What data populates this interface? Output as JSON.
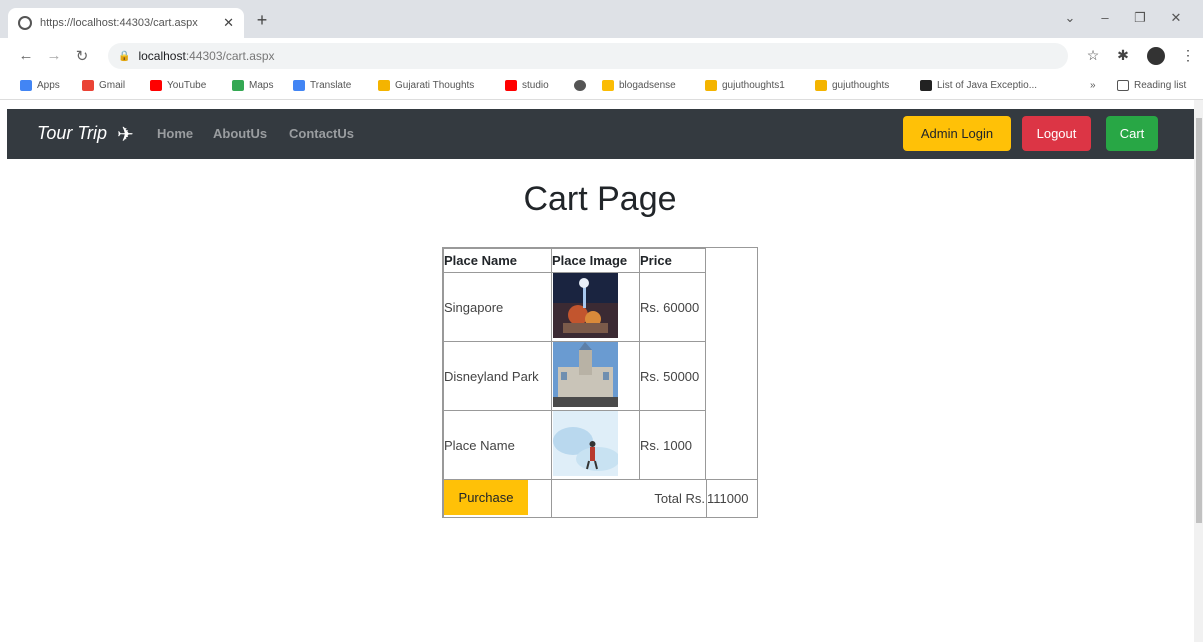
{
  "browser": {
    "tab_title": "https://localhost:44303/cart.aspx",
    "new_tab": "+",
    "url_host": "localhost",
    "url_path": ":44303/cart.aspx",
    "bookmarks": [
      "Apps",
      "Gmail",
      "YouTube",
      "Maps",
      "Translate",
      "Gujarati Thoughts",
      "studio",
      "",
      "blogadsense",
      "gujuthoughts1",
      "gujuthoughts",
      "List of Java Exceptio...",
      "»",
      "Reading list"
    ]
  },
  "navbar": {
    "brand": "Tour Trip",
    "links": [
      "Home",
      "AboutUs",
      "ContactUs"
    ],
    "admin_login": "Admin Login",
    "logout": "Logout",
    "cart": "Cart"
  },
  "page": {
    "title": "Cart Page"
  },
  "cart": {
    "headers": [
      "Place Name",
      "Place Image",
      "Price"
    ],
    "rows": [
      {
        "place": "Singapore",
        "price": "Rs. 60000"
      },
      {
        "place": "Disneyland Park",
        "price": "Rs. 50000"
      },
      {
        "place": "Place Name",
        "price": "Rs. 1000"
      }
    ],
    "purchase_label": "Purchase",
    "total_label": "Total Rs.",
    "total_value": "111000"
  }
}
